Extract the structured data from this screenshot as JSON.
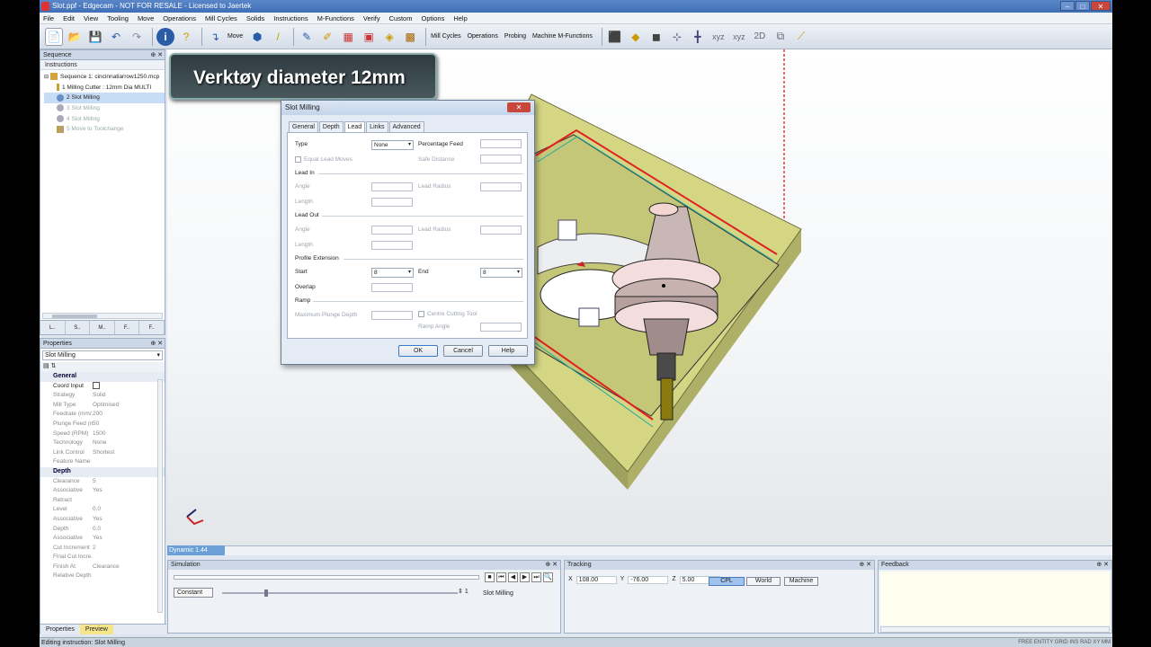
{
  "window": {
    "title": "Slot.ppf - Edgecam - NOT FOR RESALE - Licensed to Jaertek"
  },
  "menu": [
    "File",
    "Edit",
    "View",
    "Tooling",
    "Move",
    "Operations",
    "Mill Cycles",
    "Solids",
    "Instructions",
    "M-Functions",
    "Verify",
    "Custom",
    "Options",
    "Help"
  ],
  "toolbar": {
    "move_label": "Move",
    "mill_cycles_label": "Mill Cycles",
    "operations_label": "Operations",
    "probing_label": "Probing",
    "machine_mfunctions_label": "Machine M-Functions"
  },
  "sequence": {
    "title": "Sequence",
    "subtitle": "Instructions",
    "items": [
      {
        "label": "Sequence 1: cincinnatiarrow1250.mcp"
      },
      {
        "label": "1 Milling Cutter : 12mm Dia MULTI"
      },
      {
        "label": "2 Slot Milling"
      },
      {
        "label": "3 Slot Milling"
      },
      {
        "label": "4 Slot Milling"
      },
      {
        "label": "5 Move to Toolchange"
      }
    ],
    "tabs": [
      "L..",
      "S..",
      "M..",
      "F..",
      "F.."
    ]
  },
  "properties": {
    "title": "Properties",
    "selector": "Slot Milling",
    "groups": [
      {
        "name": "General",
        "rows": [
          {
            "k": "Coord Input",
            "v": ""
          },
          {
            "k": "Strategy",
            "v": "Solid"
          },
          {
            "k": "Mill Type",
            "v": "Optimised"
          },
          {
            "k": "Feedrate (mm/...",
            "v": "200"
          },
          {
            "k": "Plunge Feed (m...",
            "v": "50"
          },
          {
            "k": "Speed (RPM)",
            "v": "1500"
          },
          {
            "k": "Technology",
            "v": "None"
          },
          {
            "k": "Link Control",
            "v": "Shortest"
          },
          {
            "k": "Feature Name",
            "v": ""
          }
        ]
      },
      {
        "name": "Depth",
        "rows": [
          {
            "k": "Clearance",
            "v": "5"
          },
          {
            "k": "Associative",
            "v": "Yes"
          },
          {
            "k": "Retract",
            "v": ""
          },
          {
            "k": "Level",
            "v": "0.0"
          },
          {
            "k": "Associative",
            "v": "Yes"
          },
          {
            "k": "Depth",
            "v": "0.0"
          },
          {
            "k": "Associative",
            "v": "Yes"
          },
          {
            "k": "Cut Increment",
            "v": "2"
          },
          {
            "k": "Final Cut Incre...",
            "v": ""
          },
          {
            "k": "Finish At",
            "v": "Clearance"
          },
          {
            "k": "Relative Depth",
            "v": ""
          }
        ]
      }
    ],
    "tab_properties": "Properties",
    "tab_preview": "Preview"
  },
  "banner": {
    "text": "Verktøy diameter 12mm"
  },
  "dialog": {
    "title": "Slot Milling",
    "tabs": [
      "General",
      "Depth",
      "Lead",
      "Links",
      "Advanced"
    ],
    "active_tab": "Lead",
    "type_label": "Type",
    "type_value": "None",
    "pct_feed_label": "Percentage Feed",
    "equal_lead_label": "Equal Lead Moves",
    "safe_distance_label": "Safe Distance",
    "lead_in_group": "Lead In",
    "angle_label": "Angle",
    "lead_radius_label": "Lead Radius",
    "length_label": "Length",
    "lead_out_group": "Lead Out",
    "profile_ext_group": "Profile Extension",
    "start_label": "Start",
    "start_value": "8",
    "end_label": "End",
    "end_value": "8",
    "overlap_label": "Overlap",
    "ramp_group": "Ramp",
    "max_plunge_label": "Maximum Plunge Depth",
    "centre_cutting_label": "Centre Cutting Tool",
    "ramp_angle_label": "Ramp Angle",
    "ok": "OK",
    "cancel": "Cancel",
    "help": "Help"
  },
  "viewport": {
    "dynamic_label": "Dynamic 1.44"
  },
  "simulation": {
    "title": "Simulation",
    "mode_label": "Constant",
    "counter": "1",
    "op_label": "Slot Milling"
  },
  "tracking": {
    "title": "Tracking",
    "x_label": "X",
    "x": "108.00",
    "y_label": "Y",
    "y": "-76.00",
    "z_label": "Z",
    "z": "5.00",
    "btn_cpl": "CPL",
    "btn_world": "World",
    "btn_machine": "Machine"
  },
  "feedback": {
    "title": "Feedback"
  },
  "status": {
    "text": "Editing instruction: Slot Milling",
    "right": "FREE  ENTITY  GRID  INS  RAD  XY  MM"
  }
}
